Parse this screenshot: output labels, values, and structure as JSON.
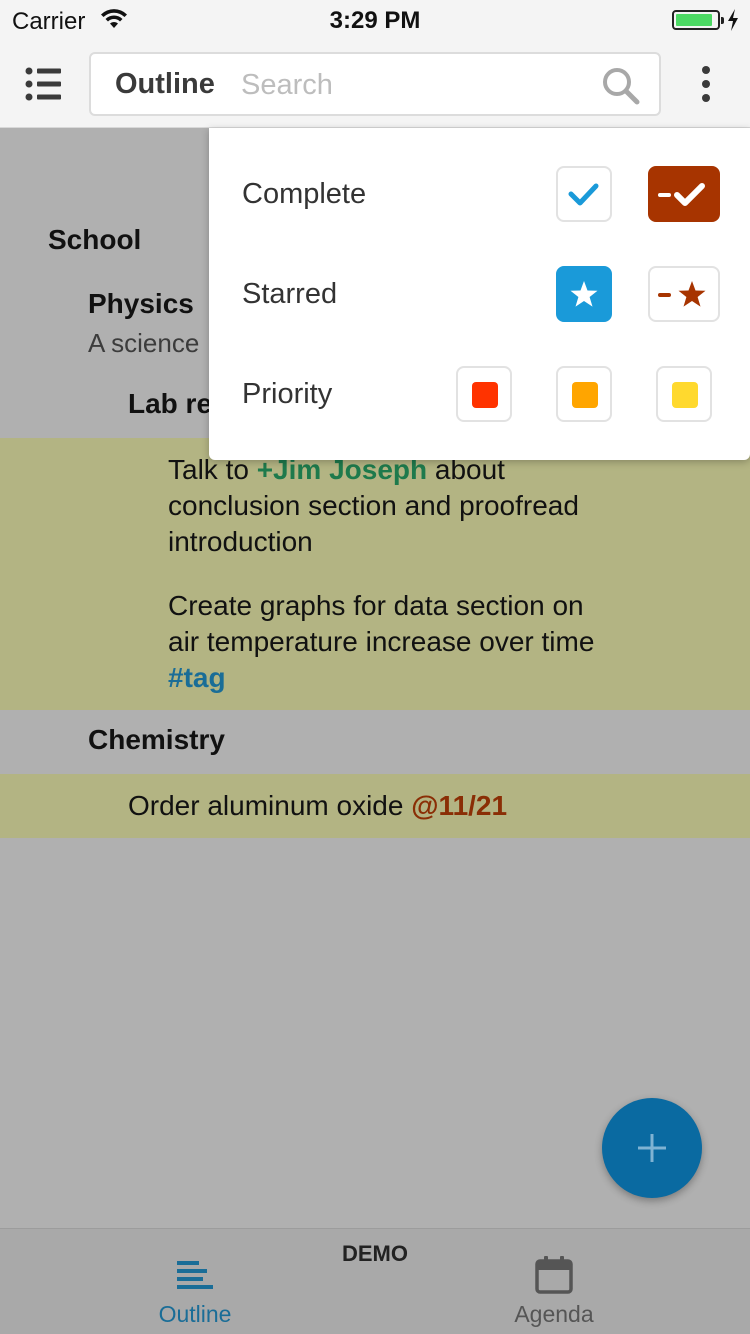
{
  "status_bar": {
    "carrier": "Carrier",
    "time": "3:29 PM",
    "battery_level": 0.9,
    "battery_color": "#4cd964"
  },
  "toolbar": {
    "menu_icon": "list-icon",
    "scope_label": "Outline",
    "search_placeholder": "Search",
    "search_icon": "search-icon",
    "more_icon": "more-vertical-icon"
  },
  "outline": {
    "school": "School",
    "physics": {
      "title": "Physics",
      "note": "A science"
    },
    "lab_report": "Lab re",
    "tasks": [
      {
        "prefix": "Talk to ",
        "mention": "+Jim Joseph",
        "suffix_line1": " about",
        "line2": "conclusion section and proofread",
        "line3": "introduction"
      },
      {
        "line1": "Create graphs for data section on",
        "line2": "air temperature increase over time",
        "tag": "#tag"
      }
    ],
    "chemistry": "Chemistry",
    "chemistry_item": {
      "text": "Order aluminum oxide ",
      "date_tag": "@11/21"
    },
    "highlight_color": "#b3b483"
  },
  "filter_menu": {
    "complete": {
      "label": "Complete",
      "show_icon": "checkmark-icon",
      "hide_icon": "minus-checkmark-icon"
    },
    "starred": {
      "label": "Starred",
      "show_icon": "star-icon",
      "hide_icon": "minus-star-icon"
    },
    "priority": {
      "label": "Priority",
      "colors": [
        "#ff3300",
        "#ffa500",
        "#ffd92e"
      ]
    },
    "accent_blue": "#1a9ad9",
    "accent_rust": "#a73400"
  },
  "fab": {
    "icon": "plus-icon",
    "color": "#0a6aa1"
  },
  "tab_bar": {
    "demo_label": "DEMO",
    "tabs": [
      {
        "label": "Outline",
        "icon": "outline-lines-icon",
        "active": true
      },
      {
        "label": "Agenda",
        "icon": "calendar-icon",
        "active": false
      }
    ],
    "active_color": "#1a6d97",
    "inactive_color": "#555555"
  }
}
